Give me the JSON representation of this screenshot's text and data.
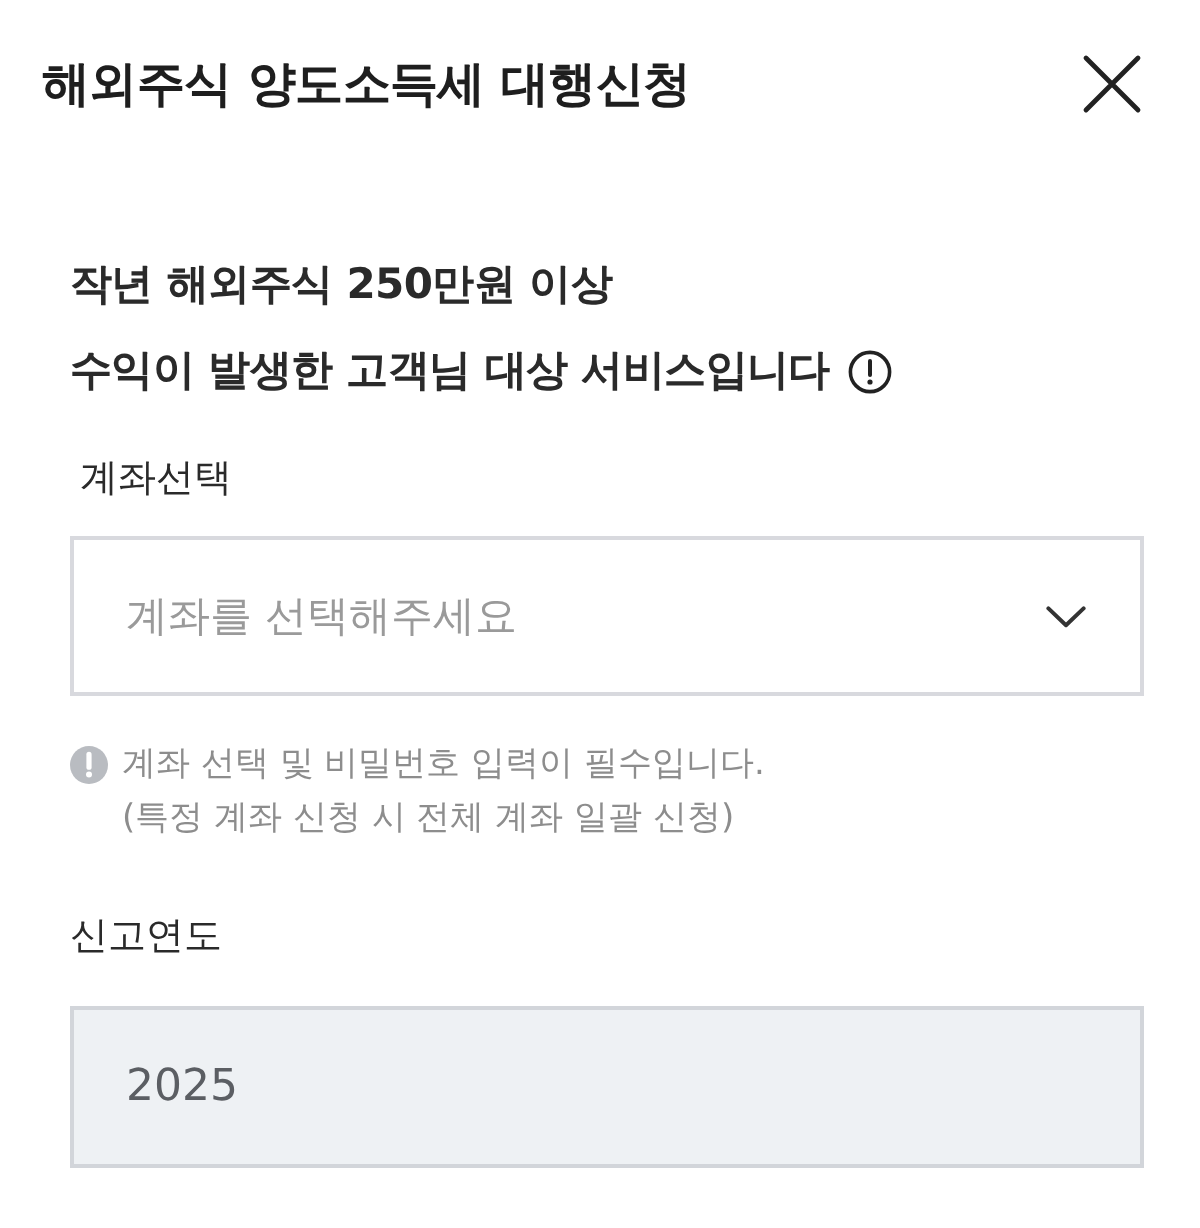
{
  "dialog": {
    "title": "해외주식 양도소득세 대행신청"
  },
  "notice": {
    "lines": [
      "작년 해외주식 250만원 이상",
      "수익이 발생한 고객님 대상 서비스입니다"
    ]
  },
  "account_select": {
    "label": "계좌선택",
    "placeholder": "계좌를 선택해주세요",
    "hint_lines": [
      "계좌 선택 및 비밀번호 입력이 필수입니다.",
      "(특정 계좌 신청 시 전체 계좌 일괄 신청)"
    ]
  },
  "report_year": {
    "label": "신고연도",
    "value": "2025",
    "disabled": true
  }
}
